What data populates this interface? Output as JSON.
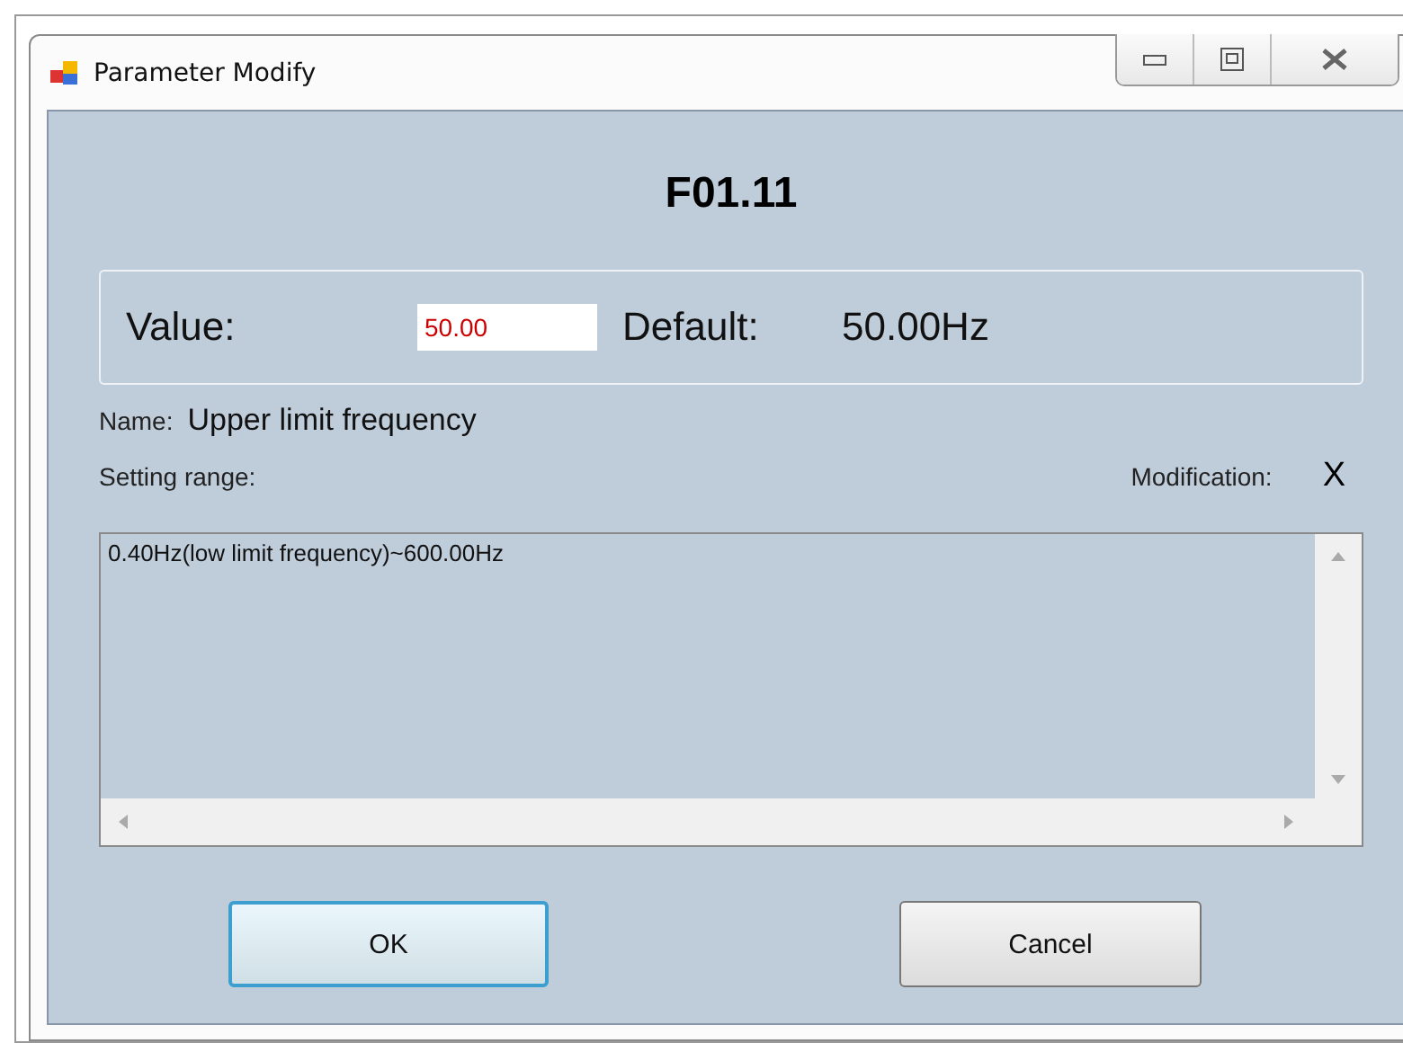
{
  "window": {
    "title": "Parameter Modify"
  },
  "code": "F01.11",
  "value": {
    "label": "Value:",
    "value": "50.00"
  },
  "default": {
    "label": "Default:",
    "value": "50.00Hz"
  },
  "name": {
    "label": "Name:",
    "value": "Upper limit frequency"
  },
  "setting_range": {
    "label": "Setting range:",
    "text": "0.40Hz(low limit frequency)~600.00Hz"
  },
  "modification": {
    "label": "Modification:",
    "value": "X"
  },
  "buttons": [
    {
      "label": "OK",
      "focused": true
    },
    {
      "label": "Cancel",
      "focused": false
    }
  ]
}
